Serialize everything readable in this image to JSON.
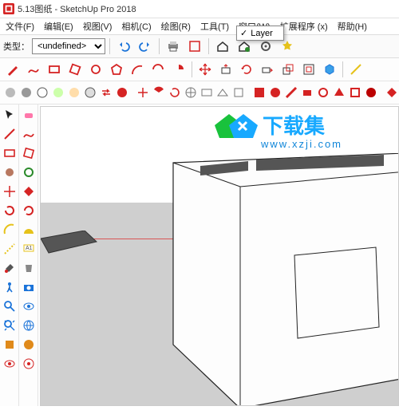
{
  "window": {
    "title": "5.13图纸 - SketchUp Pro 2018"
  },
  "menu": {
    "items": [
      "文件(F)",
      "编辑(E)",
      "视图(V)",
      "相机(C)",
      "绘图(R)",
      "工具(T)",
      "窗口(W)",
      "扩展程序 (x)",
      "帮助(H)"
    ]
  },
  "classbar": {
    "label": "类型：",
    "value": "<undefined>"
  },
  "popup": {
    "checked": true,
    "label": "Layer"
  },
  "watermark": {
    "brand": "下载集",
    "url": "www.xzji.com"
  },
  "top_toolbar2_icons": [
    "select",
    "eraser",
    "pencil",
    "freehand",
    "arc1",
    "arc2",
    "arc3",
    "arc4",
    "sep",
    "move",
    "rotate",
    "scale",
    "box1",
    "box2",
    "cube",
    "glue",
    "paint",
    "sep",
    "plan",
    "color",
    "drop"
  ],
  "top_toolbar3_icons": [
    "circle1",
    "circle2",
    "circle3",
    "circle4",
    "circle5",
    "circle6",
    "swap",
    "redcirc",
    "sep",
    "movex",
    "fanx",
    "rotatex",
    "nav1",
    "nav2",
    "nav3",
    "nav4",
    "sep",
    "red1",
    "red2",
    "red3",
    "red4",
    "red5",
    "red6",
    "red7",
    "red8",
    "sep",
    "diamond"
  ],
  "left_col1": [
    "select",
    "line",
    "rect",
    "circle",
    "diamond",
    "rotate-red",
    "arc-tool",
    "measure",
    "paint",
    "walk",
    "zoom",
    "map",
    "section",
    "eye"
  ],
  "left_col2": [
    "eraser",
    "pencil",
    "rect2",
    "ring",
    "diamond2",
    "rot2",
    "protractor",
    "text",
    "bucket",
    "camera",
    "eye2",
    "globe",
    "sphere",
    "target"
  ],
  "colors": {
    "red": "#d52323",
    "blue": "#1a73d9",
    "green": "#2a8a2a",
    "orange": "#e08a1a",
    "yellow": "#e6c21a",
    "grey": "#777"
  }
}
